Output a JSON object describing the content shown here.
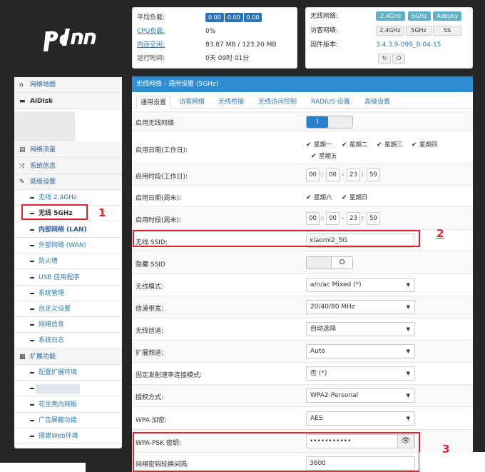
{
  "stats": {
    "labels": {
      "load": "平均负载:",
      "cpu": "CPU负载:",
      "mem": "内存空闲:",
      "uptime": "运行时间:"
    },
    "load_values": [
      "0.00",
      "0.00",
      "0.00"
    ],
    "cpu": "0%",
    "mem": "83.87 MB / 123.20 MB",
    "uptime": "0天 09时 01分"
  },
  "firmware": {
    "labels": {
      "wireless": "无线网络:",
      "guest": "访客网络:",
      "version": "固件版本:"
    },
    "wireless_buttons": [
      "2.4GHz",
      "5GHz",
      "Adbyby"
    ],
    "guest_buttons": [
      "2.4GHz",
      "5GHz",
      "SS"
    ],
    "version": "3.4.3.9-099_8-04-15"
  },
  "sidebar": {
    "items": [
      {
        "label": "网络地图",
        "icon": "home-icon"
      },
      {
        "label": "AiDisk",
        "icon": "hdd-icon"
      },
      {
        "label": "网络流量",
        "icon": "chart-icon"
      },
      {
        "label": "系统信息",
        "icon": "shuffle-icon"
      },
      {
        "label": "高级设置",
        "icon": "wrench-icon"
      }
    ],
    "advanced": [
      "无线 2.4GHz",
      "无线 5GHz",
      "内部网络 (LAN)",
      "外部网络 (WAN)",
      "防火墙",
      "USB 应用程序",
      "系统管理",
      "自定义设置",
      "网络信息",
      "系统日志"
    ],
    "extension": {
      "label": "扩展功能",
      "icon": "grid-icon"
    },
    "ext_items": [
      "配置扩展环境",
      "",
      "花生壳内网版",
      "广告屏蔽功能",
      "搭建Web环境"
    ]
  },
  "main": {
    "title": "无线网络 - 通用设置 (5GHz)",
    "tabs": [
      "通用设置",
      "访客网络",
      "无线桥接",
      "无线访问控制",
      "RADIUS 设置",
      "高级设置"
    ],
    "enable_wireless": {
      "label": "启用无线网络",
      "value": "I"
    },
    "weekday_dates": {
      "label": "启用日期(工作日):",
      "days": [
        "星期一",
        "星期二",
        "星期三",
        "星期四",
        "星期五"
      ]
    },
    "weekday_times": {
      "label": "启用时段(工作日):",
      "values": [
        "00",
        "00",
        "23",
        "59"
      ]
    },
    "weekend_dates": {
      "label": "启用日期(周末):",
      "days": [
        "星期六",
        "星期日"
      ]
    },
    "weekend_times": {
      "label": "启用时段(周末):",
      "values": [
        "00",
        "00",
        "23",
        "59"
      ]
    },
    "ssid": {
      "label": "无线 SSID:",
      "value": "xiaomi2_5G"
    },
    "hide_ssid": {
      "label": "隐藏 SSID",
      "value": "O"
    },
    "mode": {
      "label": "无线模式:",
      "value": "a/n/ac Mixed (*)"
    },
    "bandwidth": {
      "label": "信道带宽:",
      "value": "20/40/80 MHz"
    },
    "channel": {
      "label": "无线信道:",
      "value": "自动选择"
    },
    "ext_channel": {
      "label": "扩展频道:",
      "value": "Auto"
    },
    "fixed_rate": {
      "label": "固定发射速率连接模式:",
      "value": "否 (*)"
    },
    "auth": {
      "label": "授权方式:",
      "value": "WPA2-Personal"
    },
    "encryption": {
      "label": "WPA 加密:",
      "value": "AES"
    },
    "psk": {
      "label": "WPA-PSK 密钥:",
      "value": "•••••••••••"
    },
    "rekey": {
      "label": "网络密钥轮换间隔:",
      "value": "3600"
    }
  },
  "annotations": [
    "1",
    "2",
    "3"
  ],
  "colors": {
    "accent": "#2d8ed4",
    "annotation": "#e0232a"
  }
}
